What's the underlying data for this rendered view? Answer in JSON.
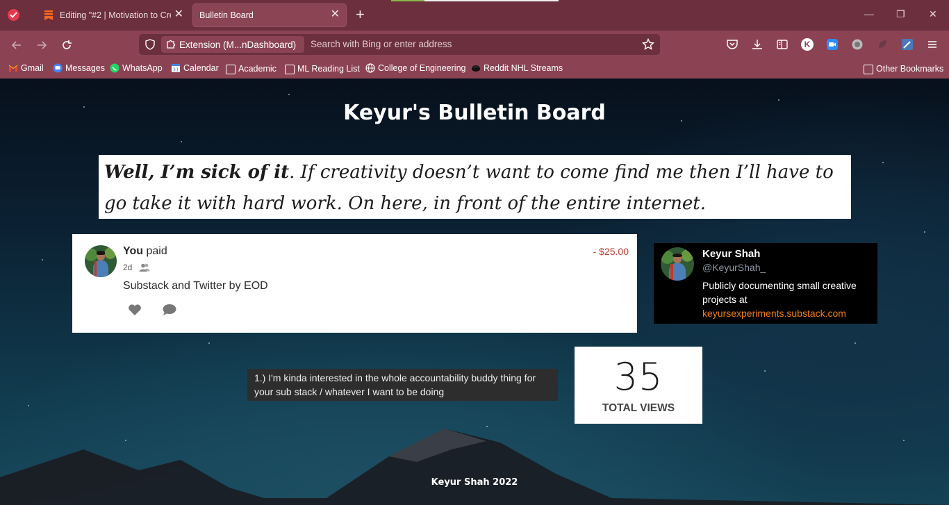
{
  "browser": {
    "tabs": [
      {
        "label": "Editing \"#2 | Motivation to Crea",
        "active": false
      },
      {
        "label": "Bulletin Board",
        "active": true
      }
    ],
    "new_tab_glyph": "+",
    "close_glyph": "✕",
    "extension_label": "Extension (M...nDashboard)",
    "address_placeholder": "Search with Bing or enter address",
    "profile_letter": "K",
    "window_controls": {
      "minimize": "—",
      "restore": "❐",
      "close": "✕"
    },
    "bookmarks": [
      {
        "label": "Gmail",
        "icon": "gmail-icon"
      },
      {
        "label": "Messages",
        "icon": "messages-icon"
      },
      {
        "label": "WhatsApp",
        "icon": "whatsapp-icon"
      },
      {
        "label": "Calendar",
        "icon": "calendar-icon"
      },
      {
        "label": "Academic",
        "icon": "folder-icon"
      },
      {
        "label": "ML Reading List",
        "icon": "folder-icon"
      },
      {
        "label": "College of Engineering",
        "icon": "globe-icon"
      },
      {
        "label": "Reddit NHL Streams",
        "icon": "reddit-icon"
      }
    ],
    "other_bookmarks": "Other Bookmarks",
    "colors": {
      "tabbar": "#6b2f3d",
      "toolbar": "#8b4353",
      "active_tab": "#8a4454"
    }
  },
  "page": {
    "title": "Keyur's Bulletin Board",
    "quote_bold": "Well, I’m sick of it",
    "quote_rest": ". If creativity doesn’t want to come find me then I’ll have to go take it with hard work. On here, in front of the entire internet.",
    "payment": {
      "actor": "You",
      "verb": " paid",
      "time": "2d",
      "amount": "- $25.00",
      "note": "Substack and Twitter by EOD",
      "amount_color": "#c0392b"
    },
    "twitter": {
      "name": "Keyur Shah",
      "handle": "@KeyurShah_",
      "bio": "Publicly documenting small creative projects at ",
      "link": "keyursexperiments.substack.com",
      "link_color": "#f07d16"
    },
    "note": "1.) I'm kinda interested in the whole accountability buddy thing for your sub stack / whatever I want to be doing",
    "views": {
      "count": "35",
      "label": "TOTAL VIEWS"
    },
    "footer": "Keyur Shah 2022"
  }
}
